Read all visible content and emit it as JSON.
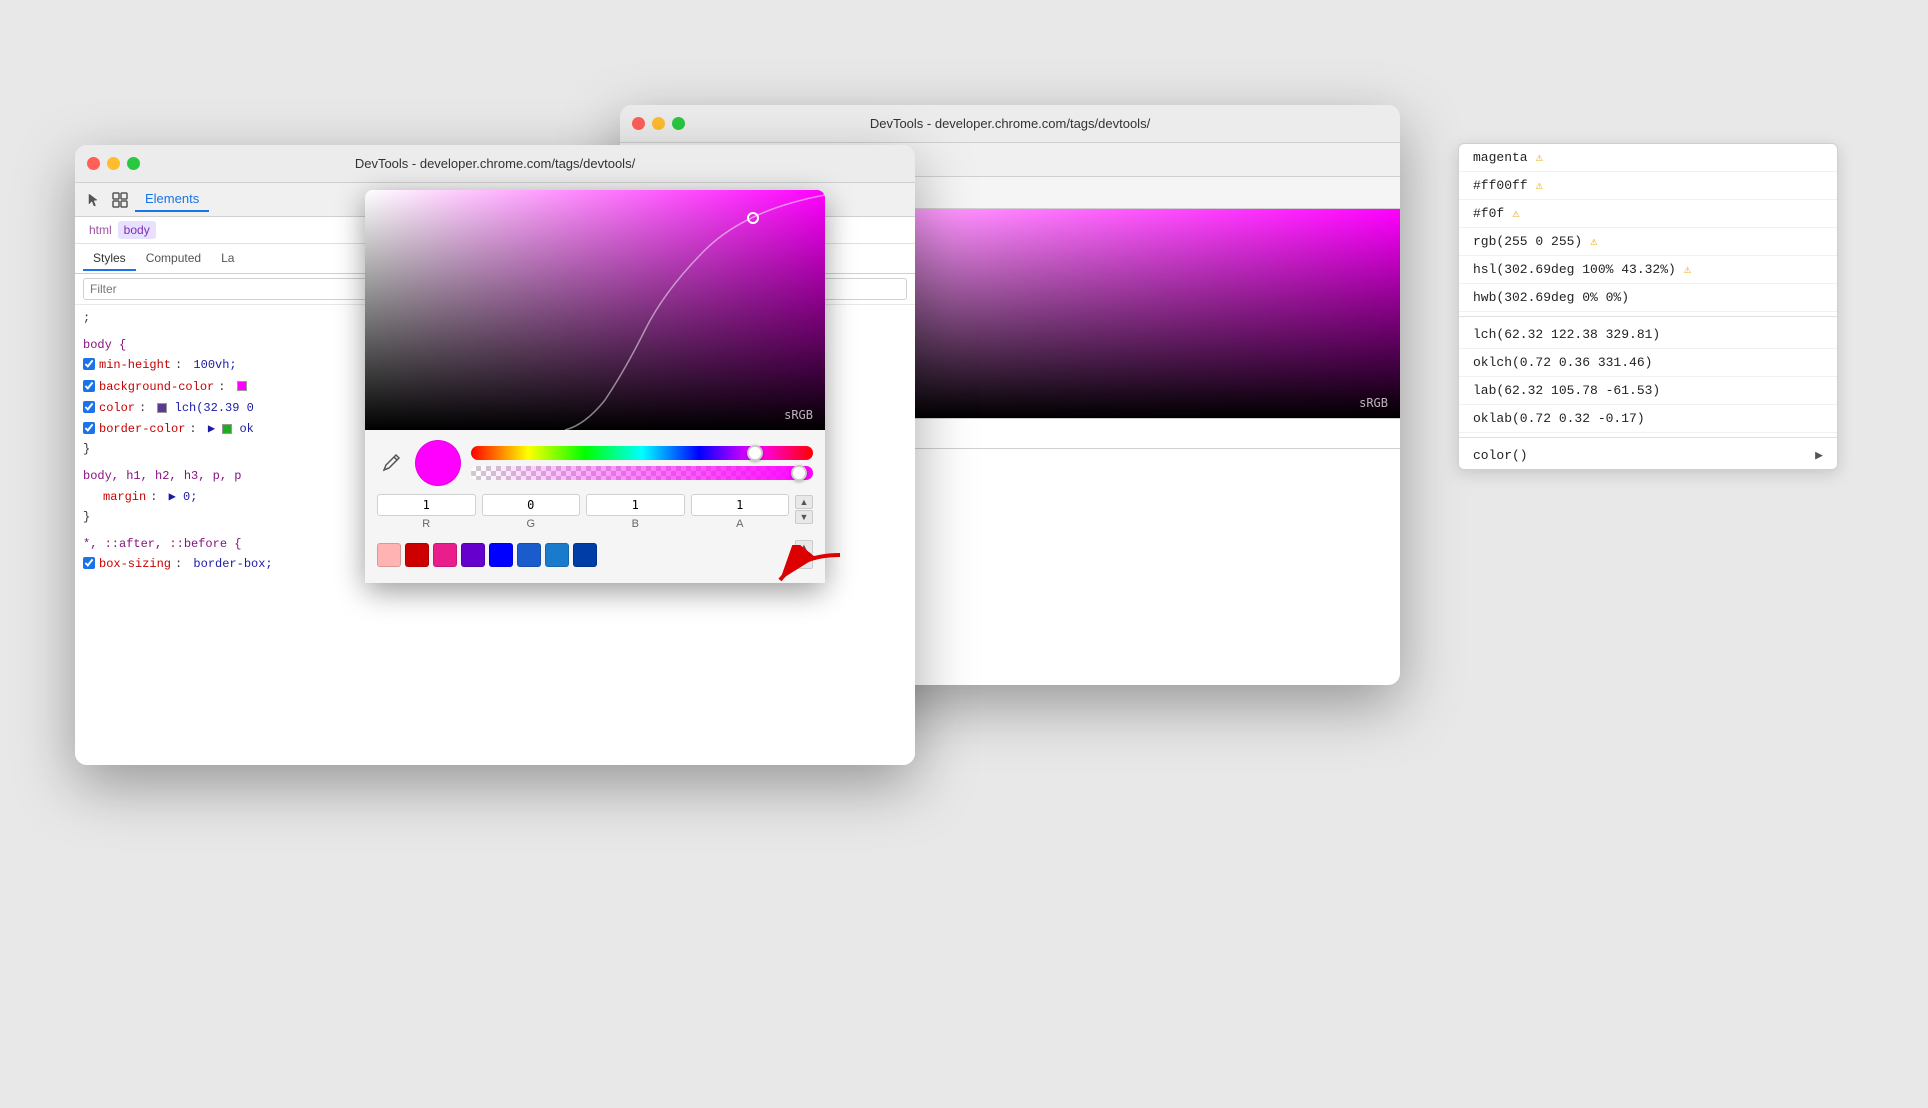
{
  "window_back": {
    "title": "DevTools - developer.chrome.com/tags/devtools/",
    "tabs": [
      "Elements"
    ],
    "panel_tabs": [
      "La"
    ],
    "css_lines": [
      "0vh;",
      "or:",
      "2.39",
      "ok"
    ],
    "swatch_colors": [
      "#ffb3b3",
      "#cc0000",
      "#e91e8c",
      "#6600cc",
      "#0000ff",
      "#1a5ccc",
      "#1a7acc",
      "#003da6"
    ],
    "stepper_value": "1",
    "channel_r": "R"
  },
  "window_front": {
    "title": "DevTools - developer.chrome.com/tags/devtools/",
    "tabs": [
      "Elements"
    ],
    "panel_tabs": [
      "Styles",
      "Computed",
      "La"
    ],
    "active_panel_tab": "Styles",
    "breadcrumbs": [
      "html",
      "body"
    ],
    "filter_placeholder": "Filter",
    "css_rules": [
      {
        "selector": ";",
        "properties": []
      },
      {
        "selector": "body {",
        "properties": [
          {
            "name": "min-height",
            "value": "100vh;"
          },
          {
            "name": "background-color",
            "value": "■"
          },
          {
            "name": "color",
            "value": "■ lch(32.39 0"
          },
          {
            "name": "border-color",
            "value": "▶ ■ ok"
          }
        ]
      },
      {
        "selector": "}",
        "properties": []
      },
      {
        "selector": "body, h1, h2, h3, p, p",
        "properties": [
          {
            "name": "margin",
            "value": "▶ 0;"
          }
        ]
      },
      {
        "selector": "}",
        "properties": []
      },
      {
        "selector": "*, ::after, ::before {",
        "properties": [
          {
            "name": "box-sizing",
            "value": "border-box;"
          }
        ]
      }
    ]
  },
  "color_picker": {
    "srgb_label": "sRGB",
    "channel_r": "1",
    "channel_g": "0",
    "channel_b": "1",
    "channel_a": "1",
    "label_r": "R",
    "label_g": "G",
    "label_b": "B",
    "label_a": "A",
    "swatches": [
      "#ffb3b3",
      "#cc0000",
      "#e91e8c",
      "#7c3aed",
      "#0000ff",
      "#1a5ccc",
      "#1a7acc",
      "#003da6"
    ]
  },
  "color_names": {
    "items": [
      {
        "label": "magenta",
        "warning": true
      },
      {
        "label": "#ff00ff",
        "warning": true
      },
      {
        "label": "#f0f",
        "warning": true
      },
      {
        "label": "rgb(255 0 255)",
        "warning": true
      },
      {
        "label": "hsl(302.69deg 100% 43.32%)",
        "warning": true
      },
      {
        "label": "hwb(302.69deg 0% 0%)",
        "warning": false
      },
      {
        "label": "lch(62.32 122.38 329.81)",
        "warning": false
      },
      {
        "label": "oklch(0.72 0.36 331.46)",
        "warning": false
      },
      {
        "label": "lab(62.32 105.78 -61.53)",
        "warning": false
      },
      {
        "label": "oklab(0.72 0.32 -0.17)",
        "warning": false
      },
      {
        "label": "color()",
        "warning": false,
        "arrow": true
      }
    ]
  }
}
